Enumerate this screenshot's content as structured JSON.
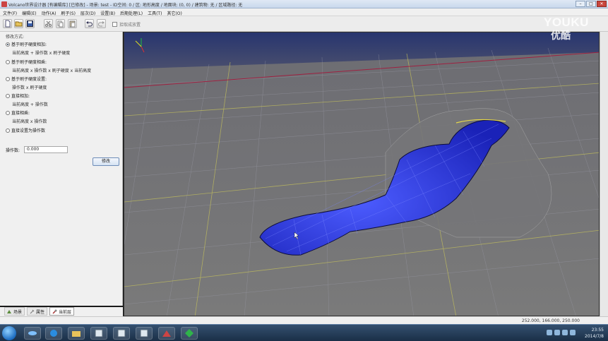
{
  "window": {
    "title": "Volcano世界设计器 [有编辑库] [已修改] - 场景: test - ID空间: 0 / 区: 地形高度 / 地面块: (0, 0) / 建筑物: 无 / 区域路径: 无",
    "minimize": "–",
    "maximize": "□",
    "close": "✕"
  },
  "menu": [
    "文件(F)",
    "编辑(E)",
    "动作(A)",
    "刷子(S)",
    "层次(D)",
    "设置(B)",
    "后期处理(L)",
    "工具(T)",
    "其它(O)"
  ],
  "toolbar": {
    "checkbox_label": "拾取成放置"
  },
  "panel": {
    "group_label": "修改方式:",
    "options": [
      {
        "label": "基于刷子硬度相加:",
        "desc": "当前高度 + 操作数 x 刷子硬度",
        "selected": true
      },
      {
        "label": "基于刷子硬度相乘:",
        "desc": "当前高度 x 操作数 x 刷子硬度 x 当前高度",
        "selected": false
      },
      {
        "label": "基于刷子硬度设置:",
        "desc": "操作数 x 刷子硬度",
        "selected": false
      },
      {
        "label": "直接相加:",
        "desc": "当前高度 + 操作数",
        "selected": false
      },
      {
        "label": "直接相乘:",
        "desc": "当前高度 x 操作数",
        "selected": false
      },
      {
        "label": "直接设置为操作数",
        "desc": "",
        "selected": false
      }
    ],
    "param_label": "操作数:",
    "param_value": "0.000",
    "apply_label": "修改"
  },
  "tabs": [
    {
      "label": "场景",
      "active": false
    },
    {
      "label": "属性",
      "active": false
    },
    {
      "label": "当前层",
      "active": true
    }
  ],
  "status": {
    "coords": "252.000, 166.000, 250.000"
  },
  "taskbar": {
    "time": "23:55",
    "date": "2014/7/8"
  },
  "watermark": {
    "top": "YOUKU",
    "bottom": "优酷"
  },
  "colors": {
    "terrain_highlight": "#2f3cff",
    "grid_line": "#d8d860",
    "sky": "#2a3a78"
  }
}
